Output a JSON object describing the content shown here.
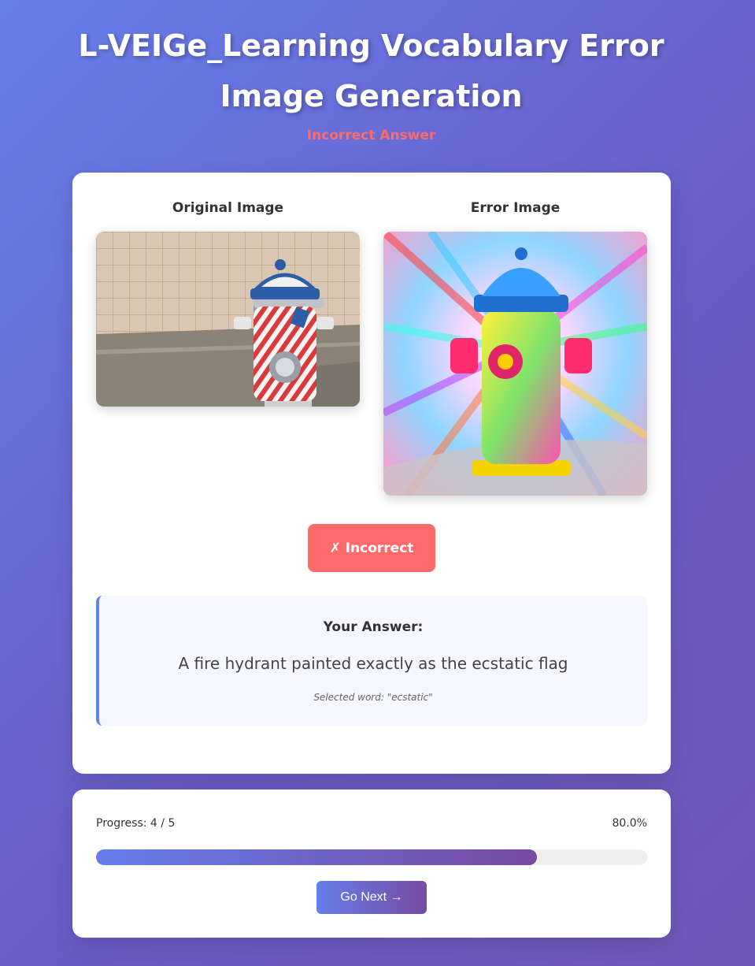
{
  "header": {
    "title_line1": "L-VEIGe_Learning Vocabulary Error",
    "title_line2": "Image Generation",
    "status": "Incorrect Answer"
  },
  "main": {
    "original_caption": "Original Image",
    "error_caption": "Error Image",
    "result_label": "✗ Incorrect",
    "answer_heading": "Your Answer:",
    "answer_text": "A fire hydrant painted exactly as the ecstatic flag",
    "selected_word": "Selected word: \"ecstatic\""
  },
  "progress": {
    "label": "Progress: 4 / 5",
    "percent_text": "80.0%",
    "fraction": 0.8,
    "next_label": "Go Next →"
  },
  "colors": {
    "accent": "#667eea",
    "accent_end": "#764ba2",
    "error": "#ff6b6b"
  }
}
